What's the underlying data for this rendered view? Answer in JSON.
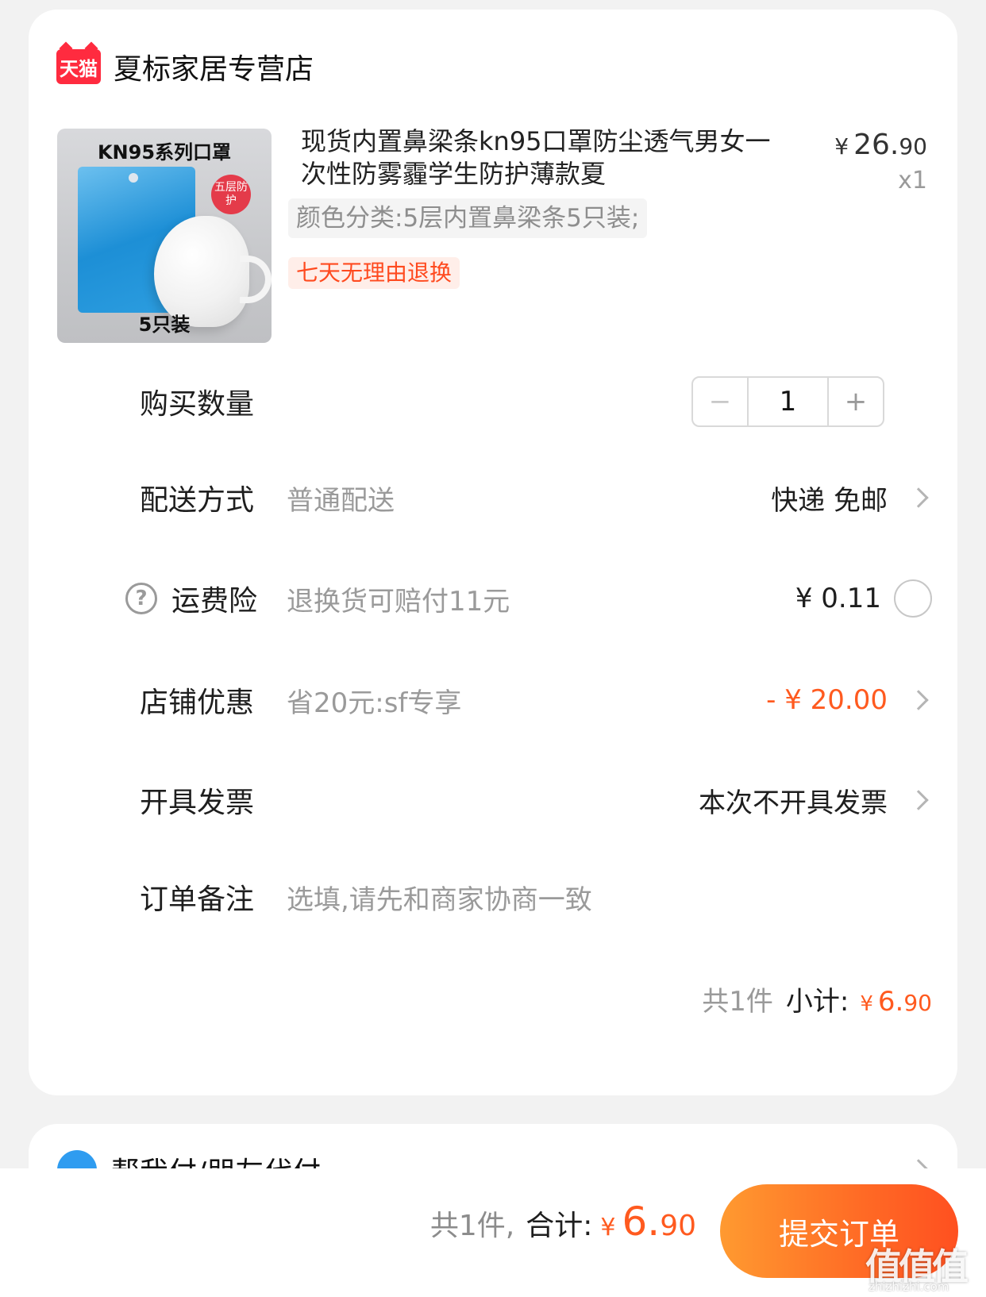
{
  "shop": {
    "badge": "天猫",
    "name": "夏标家居专营店"
  },
  "product": {
    "image": {
      "header": "KN95系列口罩",
      "badge": "五层防护",
      "footer": "5只装"
    },
    "title": "现货内置鼻梁条kn95口罩防尘透气男女一次性防雾霾学生防护薄款夏",
    "price_currency": "¥",
    "price_int": "26.",
    "price_dec": "90",
    "quantity_mark": "x1",
    "sku": "颜色分类:5层内置鼻梁条5只装;",
    "return_tag": "七天无理由退换"
  },
  "quantity": {
    "label": "购买数量",
    "value": "1",
    "minus": "−",
    "plus": "+"
  },
  "delivery": {
    "label": "配送方式",
    "sub": "普通配送",
    "value": "快递 免邮"
  },
  "insurance": {
    "label": "运费险",
    "sub": "退换货可赔付11元",
    "value": "¥ 0.11"
  },
  "discount": {
    "label": "店铺优惠",
    "sub": "省20元:sf专享",
    "value": "- ¥ 20.00"
  },
  "invoice": {
    "label": "开具发票",
    "value": "本次不开具发票"
  },
  "note": {
    "label": "订单备注",
    "placeholder": "选填,请先和商家协商一致"
  },
  "subtotal": {
    "count": "共1件",
    "label": "小计:",
    "currency": "¥",
    "int": "6.",
    "dec": "90"
  },
  "pay_for_me": {
    "label": "帮我付/朋友代付"
  },
  "footer": {
    "count": "共1件,",
    "label": "合计:",
    "currency": "¥",
    "int": "6.",
    "dec": "90",
    "submit": "提交订单"
  },
  "watermark": {
    "mark": "值值值",
    "url": "zhizhizhi.com"
  },
  "colors": {
    "accent": "#ff5a1f",
    "tmall": "#ff2b3f",
    "submit_start": "#ff9a30",
    "submit_end": "#ff5020"
  }
}
